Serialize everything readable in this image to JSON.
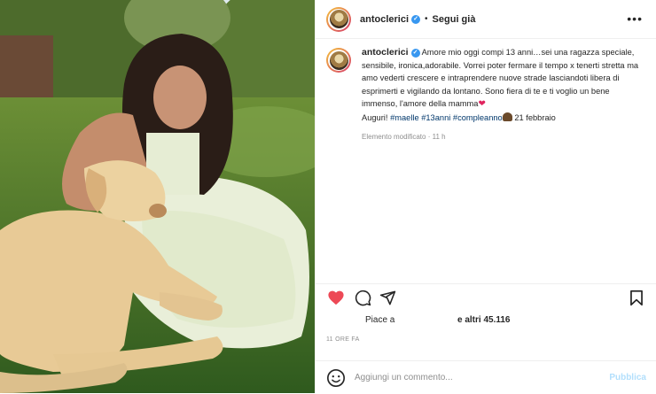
{
  "post": {
    "author": "antoclerici",
    "follow_status": "Segui già",
    "caption": {
      "username": "antoclerici",
      "text": "Amore mio oggi compi 13 anni…sei una ragazza speciale, sensibile, ironica,adorabile. Vorrei poter fermare il tempo x tenerti stretta ma amo vederti crescere e intraprendere nuove strade lasciandoti libera di esprimerti e vigilando da lontano. Sono fiera di te e ti voglio un bene immenso, l'amore della mamma",
      "greeting": "Auguri!",
      "hashtags": [
        "#maelle",
        "#13anni",
        "#compleanno"
      ],
      "date_text": "21 febbraio",
      "edited_meta": "Elemento modificato · 11 h"
    },
    "likes": {
      "prefix": "Piace a",
      "suffix": "e altri 45.116"
    },
    "time_ago": "11 ORE FA",
    "comment": {
      "placeholder": "Aggiungi un commento...",
      "publish_label": "Pubblica"
    }
  },
  "icons": [
    "verified-icon",
    "more-icon",
    "heart-icon",
    "comment-icon",
    "share-icon",
    "save-icon",
    "emoji-icon"
  ],
  "colors": {
    "like_red": "#ed4956",
    "verified_blue": "#3897f0",
    "hashtag": "#00376b",
    "muted": "#8e8e8e",
    "publish_disabled": "#b2dffc"
  }
}
